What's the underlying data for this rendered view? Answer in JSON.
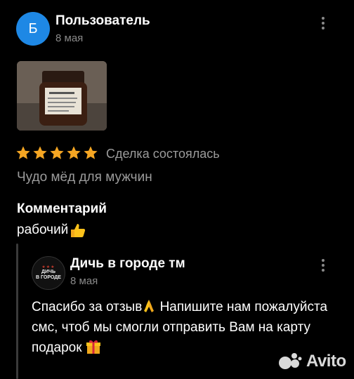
{
  "review": {
    "avatar_letter": "Б",
    "author": "Пользователь",
    "date": "8 мая",
    "rating": 5,
    "deal_status": "Сделка состоялась",
    "product": "Чудо мёд для мужчин",
    "comment_heading": "Комментарий",
    "comment": "рабочий"
  },
  "reply": {
    "shop_name": "Дичь в городе тм",
    "date": "8 мая",
    "text_part1": "Спасибо за отзыв",
    "text_part2": " Напишите нам пожалуйста смс, чтоб мы смогли отправить Вам на карту подарок ",
    "logo_text_line1": "ДИЧЬ",
    "logo_text_line2": "В ГОРОДЕ"
  },
  "watermark": {
    "text": "Avito"
  },
  "colors": {
    "avatar": "#1e88e5",
    "star": "#f5a623",
    "muted": "#9b9b9b"
  }
}
